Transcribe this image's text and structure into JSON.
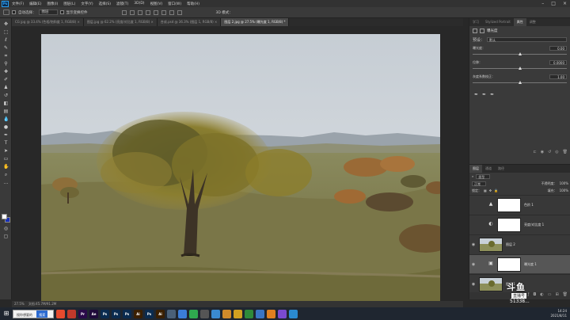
{
  "app": {
    "logo": "Ps"
  },
  "menu": [
    "文件(F)",
    "编辑(E)",
    "图像(I)",
    "图层(L)",
    "文字(Y)",
    "选择(S)",
    "滤镜(T)",
    "3D(D)",
    "视图(V)",
    "窗口(W)",
    "帮助(H)"
  ],
  "options": {
    "auto_select": "自动选择：",
    "target": "图层",
    "show_transform": "显示变换控件",
    "mode3d": "3D 模式："
  },
  "tabs": [
    "CG  jpg @ 33.4% (色相/饱和度 1, RGB/8) ×",
    "图层.jpg @ 62.2% (亮度/对比度 1, RGB/8) ×",
    "合成.psd @ 36.3% (图层 1, RGB/8) ×",
    "图层 2.jpg @ 27.5% (曝光度 1, RGB/8) *"
  ],
  "status": {
    "zoom": "27.5%",
    "doc": "文档:45.7M/91.2M"
  },
  "properties": {
    "tabs": [
      "学习",
      "Stylized Portrait",
      "属性",
      "调整"
    ],
    "type_label": "曝光度",
    "preset_label": "预设：",
    "preset_value": "默认",
    "sliders": [
      {
        "name": "曝光度：",
        "value": "0.00",
        "pos": 0.5
      },
      {
        "name": "位移：",
        "value": "0.0000",
        "pos": 0.5
      },
      {
        "name": "灰度系数校正：",
        "value": "1.00",
        "pos": 0.5
      }
    ]
  },
  "layers": {
    "tabs": [
      "图层",
      "通道",
      "路径"
    ],
    "kind": "类型",
    "blend": "正常",
    "opacity_label": "不透明度：",
    "opacity": "100%",
    "lock_label": "锁定：",
    "fill_label": "填充：",
    "fill": "100%",
    "items": [
      {
        "name": "色阶 1",
        "kind": "adj",
        "icon": "▲",
        "visible": false,
        "selected": false
      },
      {
        "name": "亮度/对比度 1",
        "kind": "adj",
        "icon": "◐",
        "visible": false,
        "selected": false
      },
      {
        "name": "图层 2",
        "kind": "photo",
        "icon": "",
        "visible": true,
        "selected": false
      },
      {
        "name": "曝光度 1",
        "kind": "adj",
        "icon": "▣",
        "visible": true,
        "selected": true
      },
      {
        "name": "图层 1",
        "kind": "photo",
        "icon": "",
        "visible": true,
        "selected": false
      }
    ]
  },
  "watermark": {
    "line1": "斗鱼",
    "line2": "直播号",
    "line3": "51338..."
  },
  "taskbar": {
    "search_placeholder": "搜你想要的",
    "search_button": "搜索",
    "apps": [
      {
        "label": "",
        "color": "#e64a2e"
      },
      {
        "label": "",
        "color": "#c0392b"
      },
      {
        "label": "Pr",
        "color": "#2a0a4a"
      },
      {
        "label": "Ae",
        "color": "#1f0a3a"
      },
      {
        "label": "Ps",
        "color": "#0a2b4f"
      },
      {
        "label": "Ps",
        "color": "#0a2b4f"
      },
      {
        "label": "Ps",
        "color": "#0a2b4f"
      },
      {
        "label": "Ai",
        "color": "#3a1f00"
      },
      {
        "label": "Ps",
        "color": "#0a2b4f"
      },
      {
        "label": "Ai",
        "color": "#3a1f00"
      },
      {
        "label": "",
        "color": "#4a6078"
      },
      {
        "label": "",
        "color": "#3b7dd8"
      },
      {
        "label": "",
        "color": "#2fa84f"
      },
      {
        "label": "",
        "color": "#555"
      },
      {
        "label": "",
        "color": "#3a8ad0"
      },
      {
        "label": "",
        "color": "#d08a2a"
      },
      {
        "label": "",
        "color": "#d2a020"
      },
      {
        "label": "",
        "color": "#2f8a3a"
      },
      {
        "label": "",
        "color": "#3a75c4"
      },
      {
        "label": "",
        "color": "#e08020"
      },
      {
        "label": "",
        "color": "#7a4ad0"
      },
      {
        "label": "",
        "color": "#2a8ad0"
      }
    ],
    "clock": "14:24",
    "date": "2021/8/11"
  }
}
